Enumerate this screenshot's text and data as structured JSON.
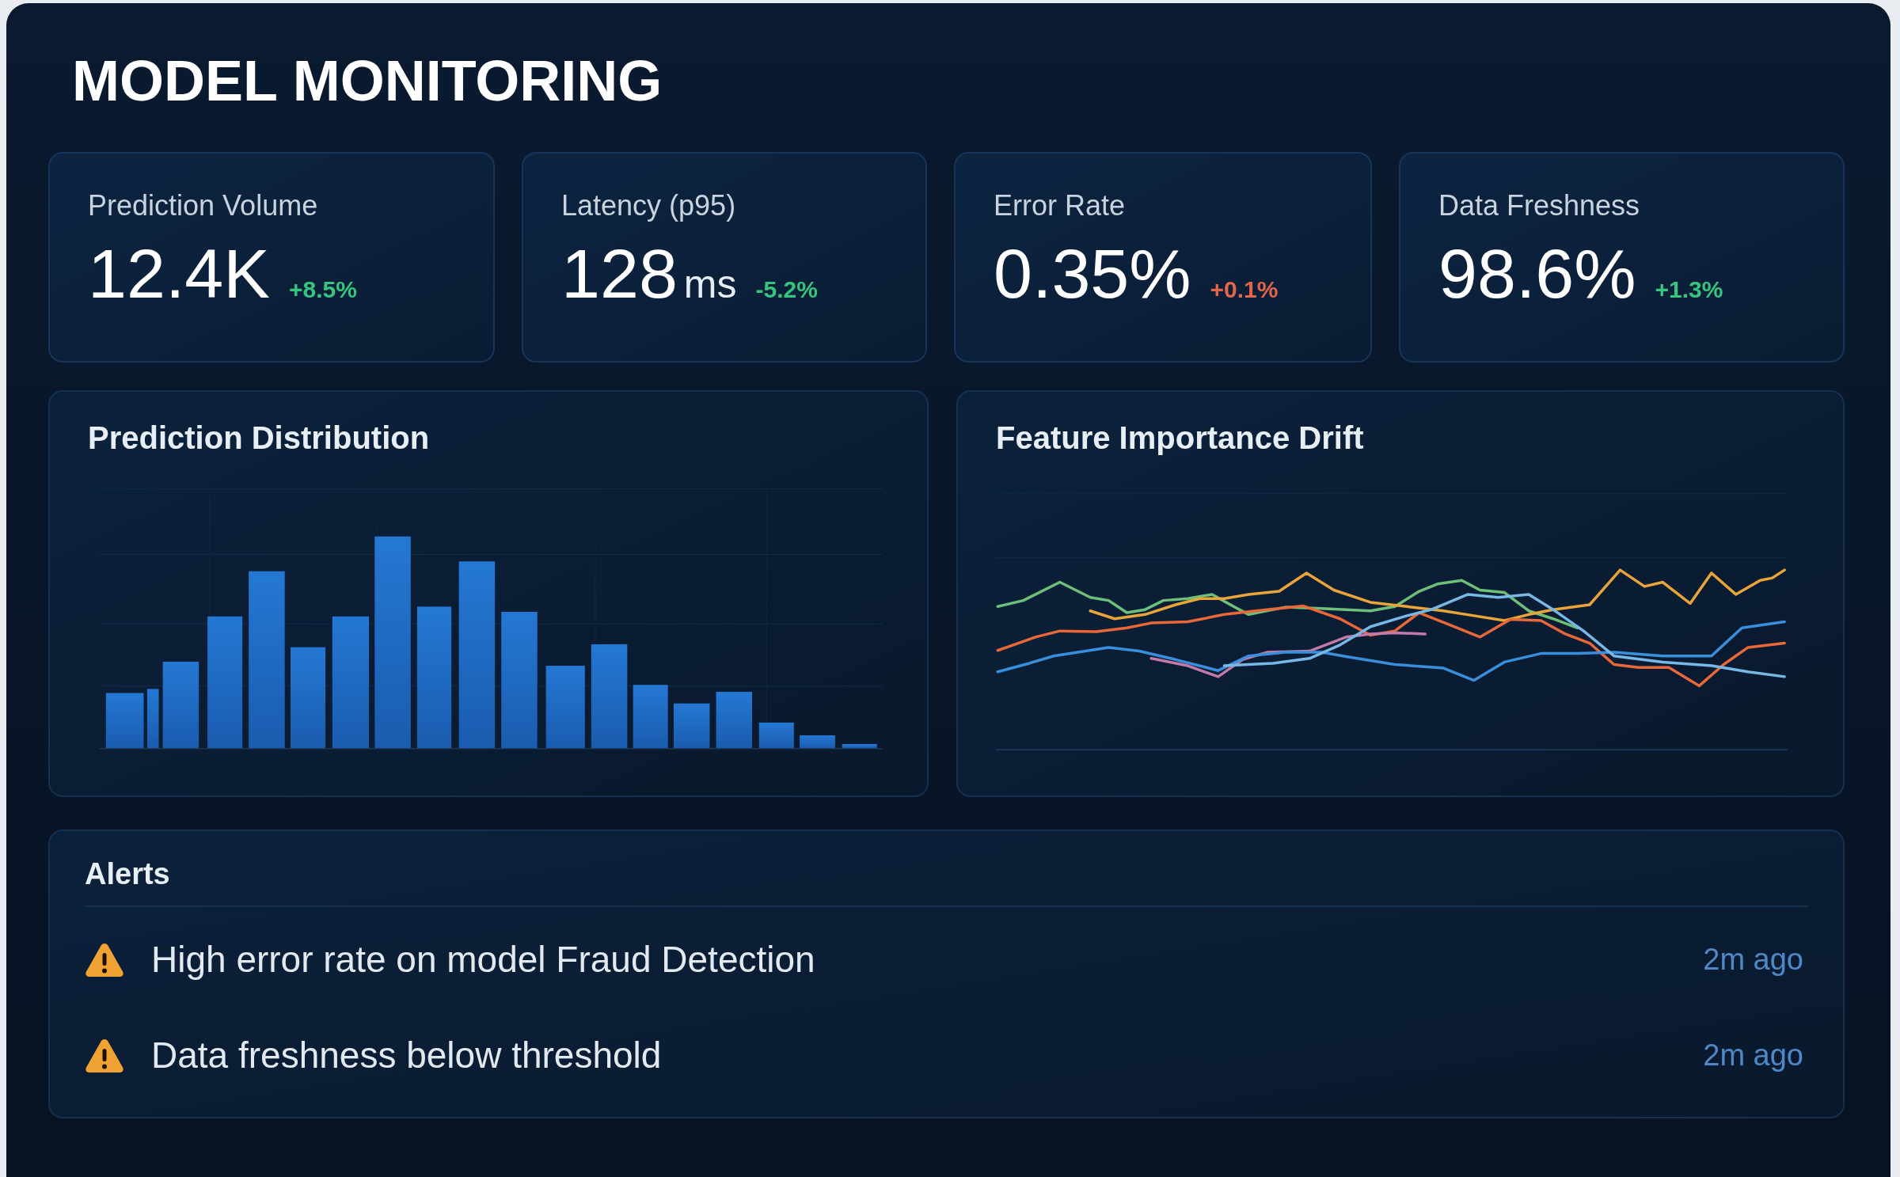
{
  "title": "MODEL MONITORING",
  "kpis": [
    {
      "label": "Prediction Volume",
      "value": "12.4K",
      "delta": "+8.5%",
      "favorable": true
    },
    {
      "label": "Latency (p95)",
      "value": "128",
      "unit": "ms",
      "delta": "-5.2%",
      "favorable": true
    },
    {
      "label": "Error Rate",
      "value": "0.35%",
      "delta": "+0.1%",
      "favorable": false
    },
    {
      "label": "Data Freshness",
      "value": "98.6%",
      "delta": "+1.3%",
      "favorable": true
    }
  ],
  "charts": [
    {
      "title": "Prediction Distribution",
      "kind": "histogram"
    },
    {
      "title": "Feature Importance Drift",
      "kind": "lines"
    }
  ],
  "alerts": {
    "title": "Alerts",
    "items": [
      {
        "message": "High error rate on model Fraud Detection",
        "time": "2m ago",
        "warning": true
      },
      {
        "message": "Data freshness below threshold",
        "time": "2m ago",
        "warning": true
      }
    ]
  }
}
